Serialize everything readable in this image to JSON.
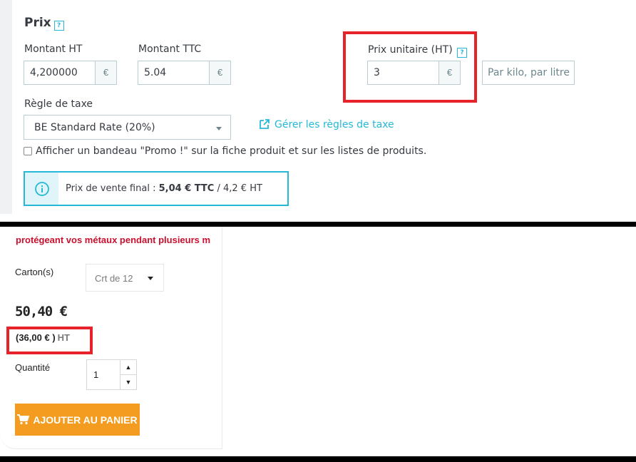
{
  "admin": {
    "section_title": "Prix",
    "help_glyph": "?",
    "montant_ht": {
      "label": "Montant HT",
      "value": "4,200000",
      "currency": "€"
    },
    "montant_ttc": {
      "label": "Montant TTC",
      "value": "5.04",
      "currency": "€"
    },
    "prix_unitaire": {
      "label": "Prix unitaire (HT)",
      "value": "3",
      "currency": "€",
      "unit_placeholder": "Par kilo, par litre"
    },
    "regle_taxe": {
      "label": "Règle de taxe",
      "selected": "BE Standard Rate (20%)"
    },
    "manage_tax_link": "Gérer les règles de taxe",
    "promo_checkbox_label": "Afficher un bandeau \"Promo !\" sur la fiche produit et sur les listes de produits.",
    "final_price": {
      "prefix": "Prix de vente final : ",
      "ttc": "5,04 € TTC",
      "separator": " / ",
      "ht": "4,2 € HT"
    }
  },
  "store": {
    "promo_text": "protégeant vos métaux pendant plusieurs m",
    "carton_label": "Carton(s)",
    "carton_selected": "Crt de 12",
    "price": "50,40 €",
    "price_ht_value": "(36,00 € )",
    "price_ht_suffix": "HT",
    "quantity_label": "Quantité",
    "quantity_value": "1",
    "qty_up_glyph": "▲",
    "qty_down_glyph": "▼",
    "add_to_cart_label": "Ajouter au panier"
  },
  "colors": {
    "accent": "#25b9d7",
    "highlight_frame": "#e6232a",
    "cart_button": "#f39c1f",
    "promo_text": "#c8102e"
  }
}
